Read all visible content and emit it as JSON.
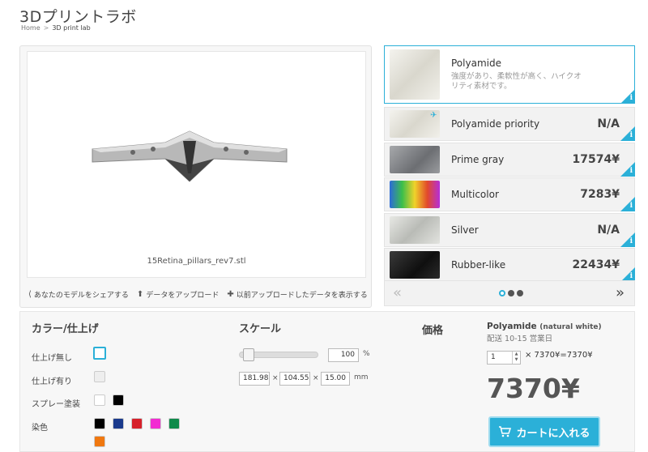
{
  "page": {
    "title": "3Dプリントラボ",
    "breadcrumb": {
      "home": "Home",
      "separator": ">",
      "current": "3D print lab"
    }
  },
  "viewer": {
    "filename": "15Retina_pillars_rev7.stl",
    "actions": [
      {
        "icon": "share-icon",
        "label": "あなたのモデルをシェアする"
      },
      {
        "icon": "upload-icon",
        "label": "データをアップロード"
      },
      {
        "icon": "plus-icon",
        "label": "以前アップロードしたデータを表示する"
      }
    ]
  },
  "materials": [
    {
      "name": "Polyamide",
      "desc": "強度があり、柔軟性が高く、ハイクオリティ素材です。",
      "price": "",
      "selected": true,
      "thumb_color": "#e9e7df"
    },
    {
      "name": "Polyamide priority",
      "price": "N/A",
      "thumb_color": "#e9e7df"
    },
    {
      "name": "Prime gray",
      "price": "17574¥",
      "thumb_color": "#8f9194"
    },
    {
      "name": "Multicolor",
      "price": "7283¥",
      "thumb_color": "#d94f2c"
    },
    {
      "name": "Silver",
      "price": "N/A",
      "thumb_color": "#d6d8d4"
    },
    {
      "name": "Rubber-like",
      "price": "22434¥",
      "thumb_color": "#1d1d1d"
    }
  ],
  "pager": {
    "prev": "«",
    "next": "»",
    "total_dots": 3,
    "active_dot": 0
  },
  "finish": {
    "title": "カラー/仕上げ",
    "options": [
      {
        "label": "仕上げ無し",
        "swatches": [
          "#ffffff"
        ],
        "selected": 0
      },
      {
        "label": "仕上げ有り",
        "swatches": [
          "#eeeeee"
        ]
      },
      {
        "label": "スプレー塗装",
        "swatches": [
          "#ffffff",
          "#000000"
        ]
      },
      {
        "label": "染色",
        "swatches": [
          "#000000",
          "#1a3a8c",
          "#d6202a",
          "#f22bd2",
          "#0f8a4a",
          "#f07810"
        ]
      }
    ]
  },
  "scale": {
    "title": "スケール",
    "percent": "100",
    "percent_unit": "%",
    "slider_level": 0.1,
    "dims": [
      "181.98",
      "104.55",
      "15.00"
    ],
    "times": "×",
    "unit": "mm"
  },
  "price": {
    "title": "価格",
    "material": "Polyamide",
    "variant": "(natural white)",
    "shipping": "配送 10-15 営業日",
    "qty": "1",
    "calc": "× 7370¥=7370¥",
    "total": "7370¥",
    "cart_label": "カートに入れる"
  },
  "colors": {
    "accent": "#2bb0d8"
  }
}
